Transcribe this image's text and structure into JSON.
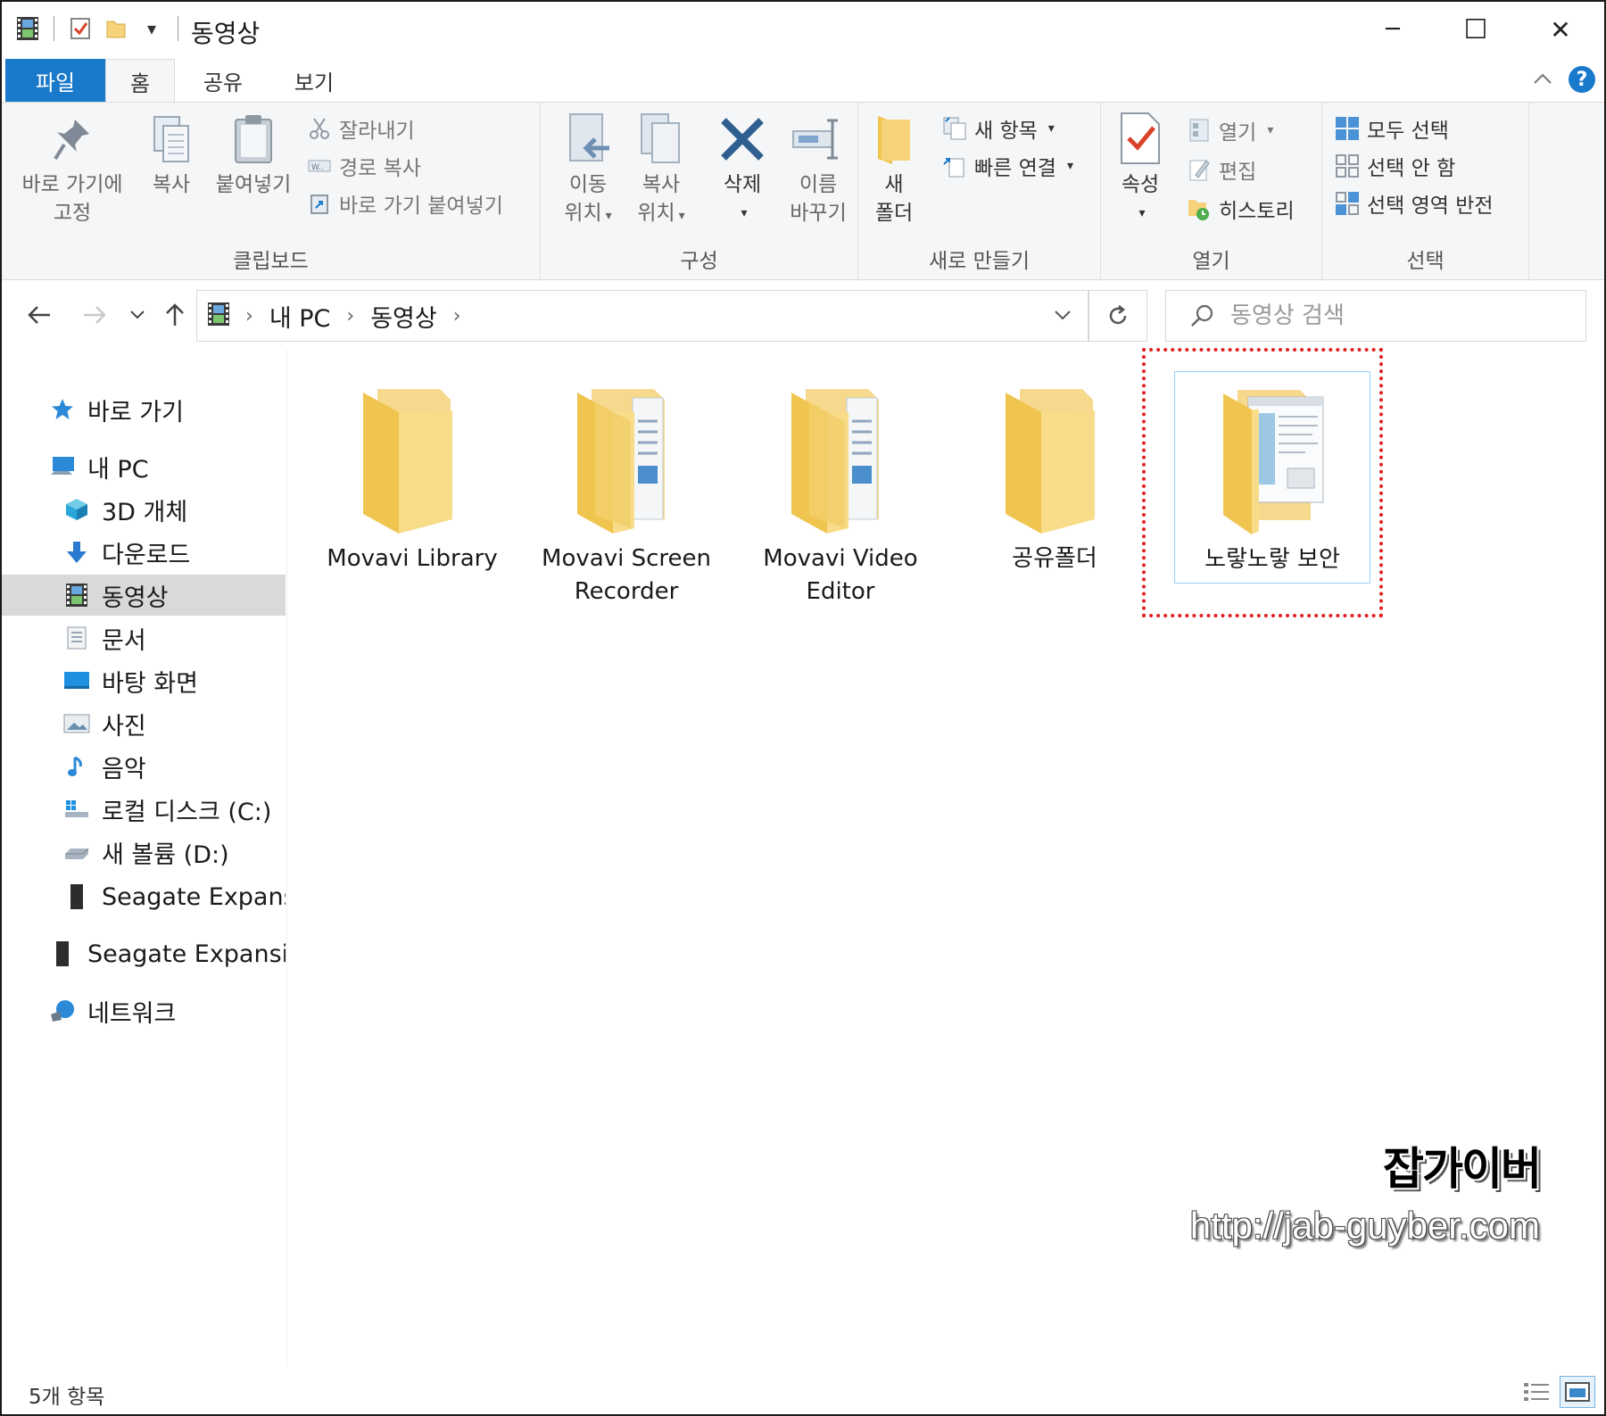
{
  "window": {
    "title": "동영상",
    "controls": {
      "minimize": "─",
      "maximize": "☐",
      "close": "✕"
    }
  },
  "quick_access": {
    "dropdown": "▾"
  },
  "ribbon_tabs": [
    {
      "label": "파일",
      "active": false
    },
    {
      "label": "홈",
      "active": true
    },
    {
      "label": "공유",
      "active": false
    },
    {
      "label": "보기",
      "active": false
    }
  ],
  "ribbon": {
    "clipboard": {
      "label": "클립보드",
      "pin": {
        "line1": "바로 가기에",
        "line2": "고정"
      },
      "copy": "복사",
      "paste": "붙여넣기",
      "cut": "잘라내기",
      "copy_path": "경로 복사",
      "paste_shortcut": "바로 가기 붙여넣기"
    },
    "organize": {
      "label": "구성",
      "move_to": {
        "line1": "이동",
        "line2": "위치"
      },
      "copy_to": {
        "line1": "복사",
        "line2": "위치"
      },
      "delete": "삭제",
      "rename": {
        "line1": "이름",
        "line2": "바꾸기"
      }
    },
    "new": {
      "label": "새로 만들기",
      "new_folder": {
        "line1": "새",
        "line2": "폴더"
      },
      "new_item": "새 항목",
      "easy_access": "빠른 연결"
    },
    "open": {
      "label": "열기",
      "properties": "속성",
      "open": "열기",
      "edit": "편집",
      "history": "히스토리"
    },
    "select": {
      "label": "선택",
      "select_all": "모두 선택",
      "select_none": "선택 안 함",
      "invert": "선택 영역 반전"
    }
  },
  "address": {
    "crumbs": [
      "내 PC",
      "동영상"
    ],
    "separator": "›",
    "search_placeholder": "동영상 검색"
  },
  "nav_pane": [
    {
      "label": "바로 가기",
      "icon": "star-icon"
    },
    {
      "label": "내 PC",
      "icon": "computer-icon"
    },
    {
      "label": "3D 개체",
      "icon": "cube-icon"
    },
    {
      "label": "다운로드",
      "icon": "download-icon"
    },
    {
      "label": "동영상",
      "icon": "film-icon",
      "selected": true
    },
    {
      "label": "문서",
      "icon": "document-icon"
    },
    {
      "label": "바탕 화면",
      "icon": "desktop-icon"
    },
    {
      "label": "사진",
      "icon": "picture-icon"
    },
    {
      "label": "음악",
      "icon": "music-icon"
    },
    {
      "label": "로컬 디스크 (C:)",
      "icon": "drive-c-icon"
    },
    {
      "label": "새 볼륨 (D:)",
      "icon": "drive-d-icon"
    },
    {
      "label": "Seagate Expansion",
      "icon": "external-drive-icon"
    },
    {
      "label": "Seagate Expansion",
      "icon": "external-drive-icon"
    },
    {
      "label": "네트워크",
      "icon": "network-icon"
    }
  ],
  "folders": [
    {
      "label": "Movavi Library",
      "type": "plain"
    },
    {
      "label": "Movavi Screen Recorder",
      "type": "docs"
    },
    {
      "label": "Movavi Video Editor",
      "type": "docs"
    },
    {
      "label": "공유폴더",
      "type": "plain"
    },
    {
      "label": "노랗노랗 보안",
      "type": "preview",
      "selected": true
    }
  ],
  "watermark": {
    "title": "잡가이버",
    "url": "http://jab-guyber.com"
  },
  "status": {
    "item_count": "5개 항목"
  },
  "colors": {
    "accent": "#1979ca",
    "highlight": "#e02020",
    "folder": "#f6d27a"
  }
}
